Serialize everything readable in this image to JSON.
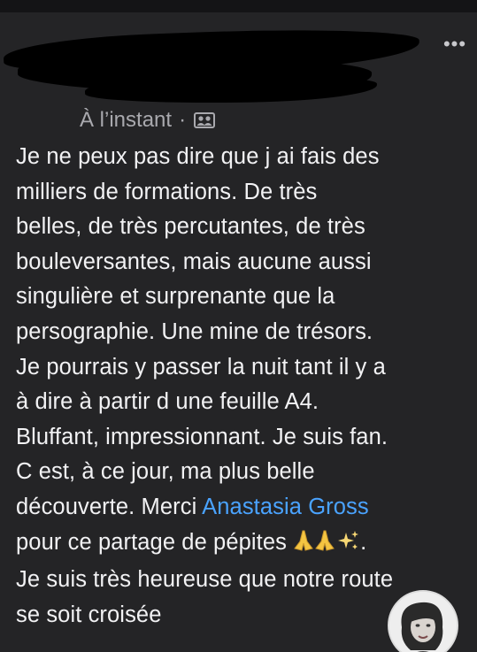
{
  "post": {
    "menu_label": "•••",
    "timestamp": "À l’instant",
    "separator": "·",
    "audience_icon": "audience-icon",
    "body_lines": [
      "Je ne peux pas dire que j ai fais des",
      "milliers de formations.  De très",
      "belles, de très percutantes, de très",
      "bouleversantes, mais aucune aussi",
      "singulière et surprenante que la",
      "persographie.  Une mine de trésors.",
      "Je pourrais y passer la nuit tant il y a",
      "à dire à partir d une feuille A4.",
      "Bluffant, impressionnant. Je suis fan.",
      "C est, à ce jour, ma plus belle"
    ],
    "line11_prefix": "découverte.  Merci ",
    "mention": "Anastasia Gross",
    "line12_prefix": "pour ce partage de pépites ",
    "line12_suffix": ".",
    "line13": "Je suis très heureuse que notre route",
    "line14": "se soit croisée"
  },
  "colors": {
    "background": "#242426",
    "text": "#f2f2f4",
    "meta": "#a9a9ae",
    "mention": "#4aa3ff"
  }
}
